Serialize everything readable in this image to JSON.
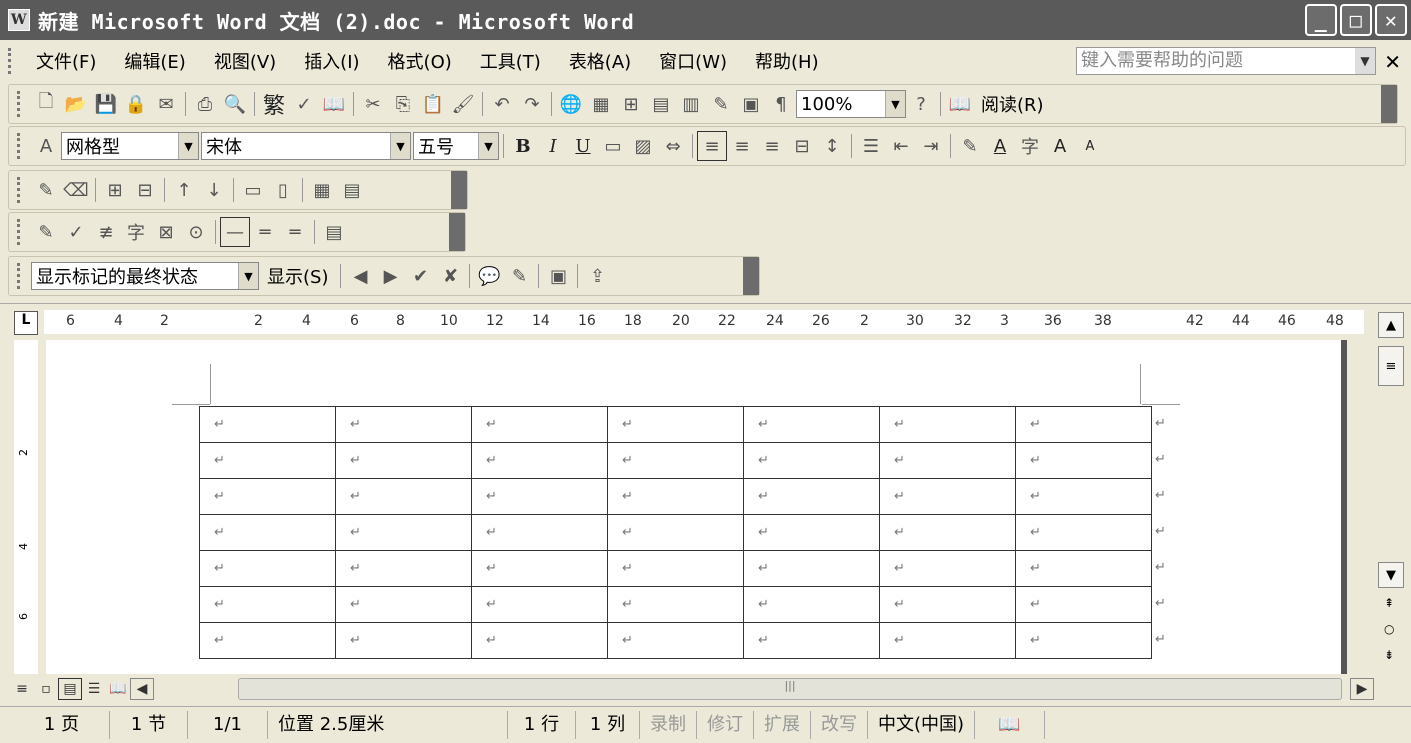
{
  "window": {
    "title": "新建 Microsoft Word 文档 (2).doc - Microsoft Word",
    "app_icon": "W",
    "minimize": "_",
    "maximize": "□",
    "close": "✕"
  },
  "menu": {
    "items": [
      "文件(F)",
      "编辑(E)",
      "视图(V)",
      "插入(I)",
      "格式(O)",
      "工具(T)",
      "表格(A)",
      "窗口(W)",
      "帮助(H)"
    ],
    "help_placeholder": "键入需要帮助的问题",
    "close": "✕"
  },
  "toolbar_standard": {
    "traditional": "繁",
    "zoom": "100%",
    "read_label": "阅读(R)"
  },
  "toolbar_format": {
    "style": "网格型",
    "font": "宋体",
    "size": "五号",
    "bold": "B",
    "italic": "I",
    "underline": "U",
    "font_a": "A",
    "grow": "A",
    "shrink": "A"
  },
  "toolbar_review": {
    "markup_state": "显示标记的最终状态",
    "show_label": "显示(S)"
  },
  "ruler": {
    "corner": "L",
    "ticks": [
      "6",
      "4",
      "2",
      "2",
      "4",
      "6",
      "8",
      "10",
      "12",
      "14",
      "16",
      "18",
      "20",
      "22",
      "24",
      "26",
      "2",
      "30",
      "32",
      "3",
      "36",
      "38",
      "42",
      "44",
      "46",
      "48"
    ],
    "vticks": [
      "2",
      "4",
      "6"
    ]
  },
  "table": {
    "rows": 7,
    "cols": 7,
    "cell_mark": "↵"
  },
  "status": {
    "page": "1 页",
    "section": "1 节",
    "pages": "1/1",
    "position": "位置 2.5厘米",
    "line": "1 行",
    "column": "1 列",
    "rec": "录制",
    "trk": "修订",
    "ext": "扩展",
    "ovr": "改写",
    "lang": "中文(中国)"
  }
}
